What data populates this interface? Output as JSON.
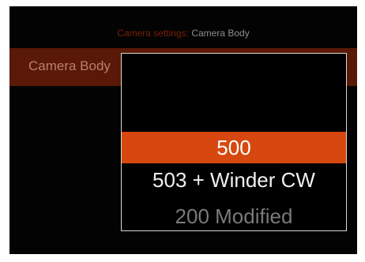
{
  "header": {
    "prefix": "Camera settings:",
    "value": "Camera Body"
  },
  "selected_row": {
    "label": "Camera Body"
  },
  "picker": {
    "options": [
      {
        "label": "500",
        "state": "selected"
      },
      {
        "label": "503 + Winder CW",
        "state": "normal"
      },
      {
        "label": "200 Modified",
        "state": "faded"
      }
    ],
    "selected_index": 0
  },
  "colors": {
    "accent": "#d6480f",
    "row_background": "#5a1806",
    "screen_background": "#030303"
  }
}
